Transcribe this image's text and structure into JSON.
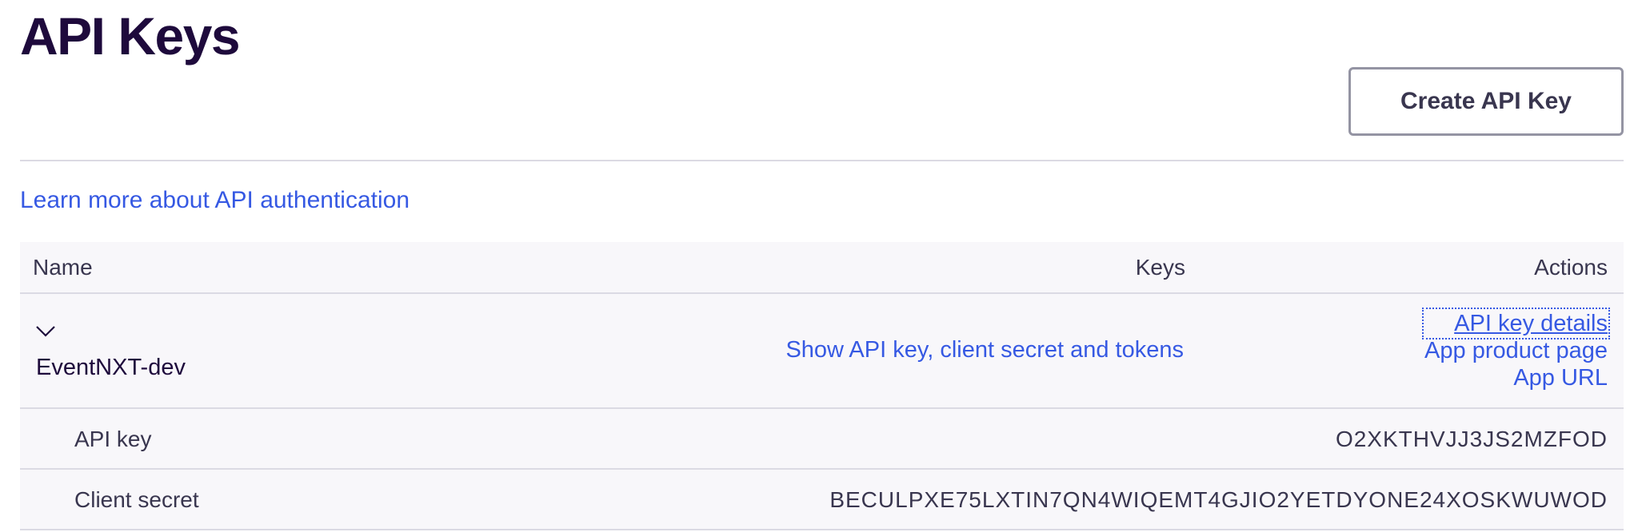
{
  "page": {
    "title": "API Keys",
    "create_button": "Create API Key",
    "learn_link": "Learn more about API authentication"
  },
  "table": {
    "columns": {
      "name": "Name",
      "keys": "Keys",
      "actions": "Actions"
    },
    "app": {
      "name": "EventNXT-dev",
      "show_link": "Show API key, client secret and tokens",
      "actions": [
        "API key details",
        "App product page",
        "App URL"
      ]
    },
    "details": [
      {
        "label": "API key",
        "value": "O2XKTHVJJ3JS2MZFOD"
      },
      {
        "label": "Client secret",
        "value": "BECULPXE75LXTIN7QN4WIQEMT4GJIO2YETDYONE24XOSKWUWOD"
      }
    ]
  },
  "colors": {
    "title": "#1e0a3c",
    "link": "#3659e3",
    "text": "#39364f",
    "table_bg": "#f8f7fa",
    "border": "#dbdae3"
  },
  "icons": {
    "expand": "chevron-down-icon"
  }
}
